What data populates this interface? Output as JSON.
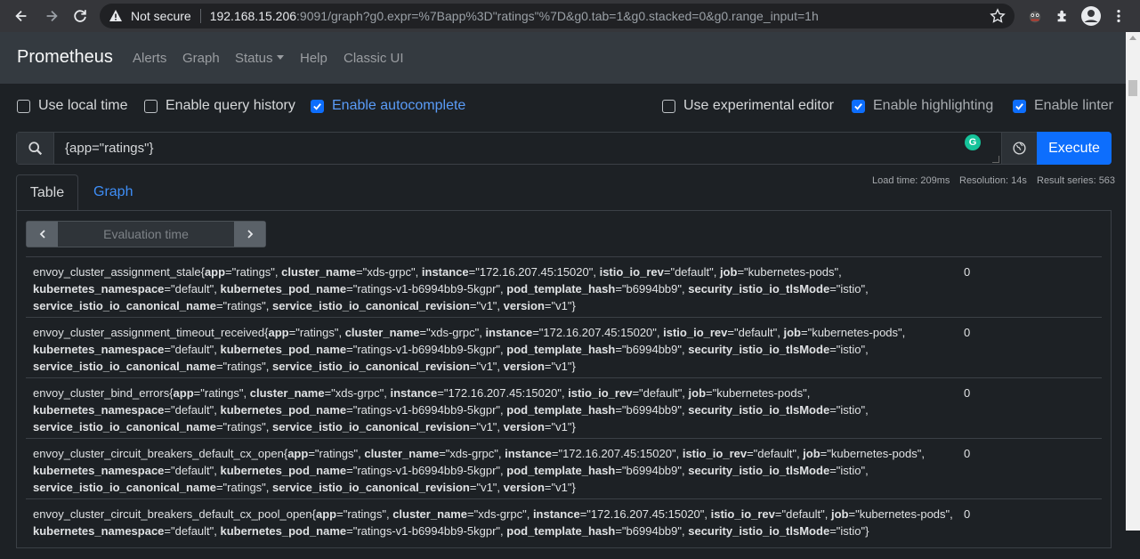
{
  "browser": {
    "security_label": "Not secure",
    "host": "192.168.15.206",
    "path": ":9091/graph?g0.expr=%7Bapp%3D\"ratings\"%7D&g0.tab=1&g0.stacked=0&g0.range_input=1h"
  },
  "nav": {
    "brand": "Prometheus",
    "alerts": "Alerts",
    "graph": "Graph",
    "status": "Status",
    "help": "Help",
    "classic_ui": "Classic UI"
  },
  "options": {
    "use_local_time": "Use local time",
    "enable_query_history": "Enable query history",
    "enable_autocomplete": "Enable autocomplete",
    "use_experimental_editor": "Use experimental editor",
    "enable_highlighting": "Enable highlighting",
    "enable_linter": "Enable linter"
  },
  "query": {
    "expr": "{app=\"ratings\"}",
    "execute_label": "Execute",
    "grammarly": "G"
  },
  "tabs": {
    "table": "Table",
    "graph": "Graph"
  },
  "stats": {
    "load_time": "Load time: 209ms",
    "resolution": "Resolution: 14s",
    "result_series": "Result series: 563"
  },
  "eval": {
    "placeholder": "Evaluation time"
  },
  "rows": [
    {
      "metric": "envoy_cluster_assignment_stale",
      "labels": [
        [
          "app",
          "\"ratings\""
        ],
        [
          "cluster_name",
          "\"xds-grpc\""
        ],
        [
          "instance",
          "\"172.16.207.45:15020\""
        ],
        [
          "istio_io_rev",
          "\"default\""
        ],
        [
          "job",
          "\"kubernetes-pods\""
        ],
        [
          "kubernetes_namespace",
          "\"default\""
        ],
        [
          "kubernetes_pod_name",
          "\"ratings-v1-b6994bb9-5kgpr\""
        ],
        [
          "pod_template_hash",
          "\"b6994bb9\""
        ],
        [
          "security_istio_io_tlsMode",
          "\"istio\""
        ],
        [
          "service_istio_io_canonical_name",
          "\"ratings\""
        ],
        [
          "service_istio_io_canonical_revision",
          "\"v1\""
        ],
        [
          "version",
          "\"v1\""
        ]
      ],
      "value": "0"
    },
    {
      "metric": "envoy_cluster_assignment_timeout_received",
      "labels": [
        [
          "app",
          "\"ratings\""
        ],
        [
          "cluster_name",
          "\"xds-grpc\""
        ],
        [
          "instance",
          "\"172.16.207.45:15020\""
        ],
        [
          "istio_io_rev",
          "\"default\""
        ],
        [
          "job",
          "\"kubernetes-pods\""
        ],
        [
          "kubernetes_namespace",
          "\"default\""
        ],
        [
          "kubernetes_pod_name",
          "\"ratings-v1-b6994bb9-5kgpr\""
        ],
        [
          "pod_template_hash",
          "\"b6994bb9\""
        ],
        [
          "security_istio_io_tlsMode",
          "\"istio\""
        ],
        [
          "service_istio_io_canonical_name",
          "\"ratings\""
        ],
        [
          "service_istio_io_canonical_revision",
          "\"v1\""
        ],
        [
          "version",
          "\"v1\""
        ]
      ],
      "value": "0"
    },
    {
      "metric": "envoy_cluster_bind_errors",
      "labels": [
        [
          "app",
          "\"ratings\""
        ],
        [
          "cluster_name",
          "\"xds-grpc\""
        ],
        [
          "instance",
          "\"172.16.207.45:15020\""
        ],
        [
          "istio_io_rev",
          "\"default\""
        ],
        [
          "job",
          "\"kubernetes-pods\""
        ],
        [
          "kubernetes_namespace",
          "\"default\""
        ],
        [
          "kubernetes_pod_name",
          "\"ratings-v1-b6994bb9-5kgpr\""
        ],
        [
          "pod_template_hash",
          "\"b6994bb9\""
        ],
        [
          "security_istio_io_tlsMode",
          "\"istio\""
        ],
        [
          "service_istio_io_canonical_name",
          "\"ratings\""
        ],
        [
          "service_istio_io_canonical_revision",
          "\"v1\""
        ],
        [
          "version",
          "\"v1\""
        ]
      ],
      "value": "0"
    },
    {
      "metric": "envoy_cluster_circuit_breakers_default_cx_open",
      "labels": [
        [
          "app",
          "\"ratings\""
        ],
        [
          "cluster_name",
          "\"xds-grpc\""
        ],
        [
          "instance",
          "\"172.16.207.45:15020\""
        ],
        [
          "istio_io_rev",
          "\"default\""
        ],
        [
          "job",
          "\"kubernetes-pods\""
        ],
        [
          "kubernetes_namespace",
          "\"default\""
        ],
        [
          "kubernetes_pod_name",
          "\"ratings-v1-b6994bb9-5kgpr\""
        ],
        [
          "pod_template_hash",
          "\"b6994bb9\""
        ],
        [
          "security_istio_io_tlsMode",
          "\"istio\""
        ],
        [
          "service_istio_io_canonical_name",
          "\"ratings\""
        ],
        [
          "service_istio_io_canonical_revision",
          "\"v1\""
        ],
        [
          "version",
          "\"v1\""
        ]
      ],
      "value": "0"
    },
    {
      "metric": "envoy_cluster_circuit_breakers_default_cx_pool_open",
      "labels": [
        [
          "app",
          "\"ratings\""
        ],
        [
          "cluster_name",
          "\"xds-grpc\""
        ],
        [
          "instance",
          "\"172.16.207.45:15020\""
        ],
        [
          "istio_io_rev",
          "\"default\""
        ],
        [
          "job",
          "\"kubernetes-pods\""
        ],
        [
          "kubernetes_namespace",
          "\"default\""
        ],
        [
          "kubernetes_pod_name",
          "\"ratings-v1-b6994bb9-5kgpr\""
        ],
        [
          "pod_template_hash",
          "\"b6994bb9\""
        ],
        [
          "security_istio_io_tlsMode",
          "\"istio\""
        ]
      ],
      "value": "0"
    }
  ],
  "icons": {
    "back": "arrow-left-icon",
    "forward": "arrow-right-icon",
    "reload": "reload-icon",
    "warning": "warning-icon",
    "star": "star-icon",
    "extension_ghost": "extension-icon",
    "puzzle": "puzzle-icon",
    "profile": "profile-icon",
    "menu": "kebab-menu-icon",
    "search": "search-icon",
    "globe": "globe-icon"
  },
  "colors": {
    "accent": "#0d6efd",
    "link": "#3e8ef7",
    "navbar": "#343a40",
    "background": "#1d2125"
  }
}
